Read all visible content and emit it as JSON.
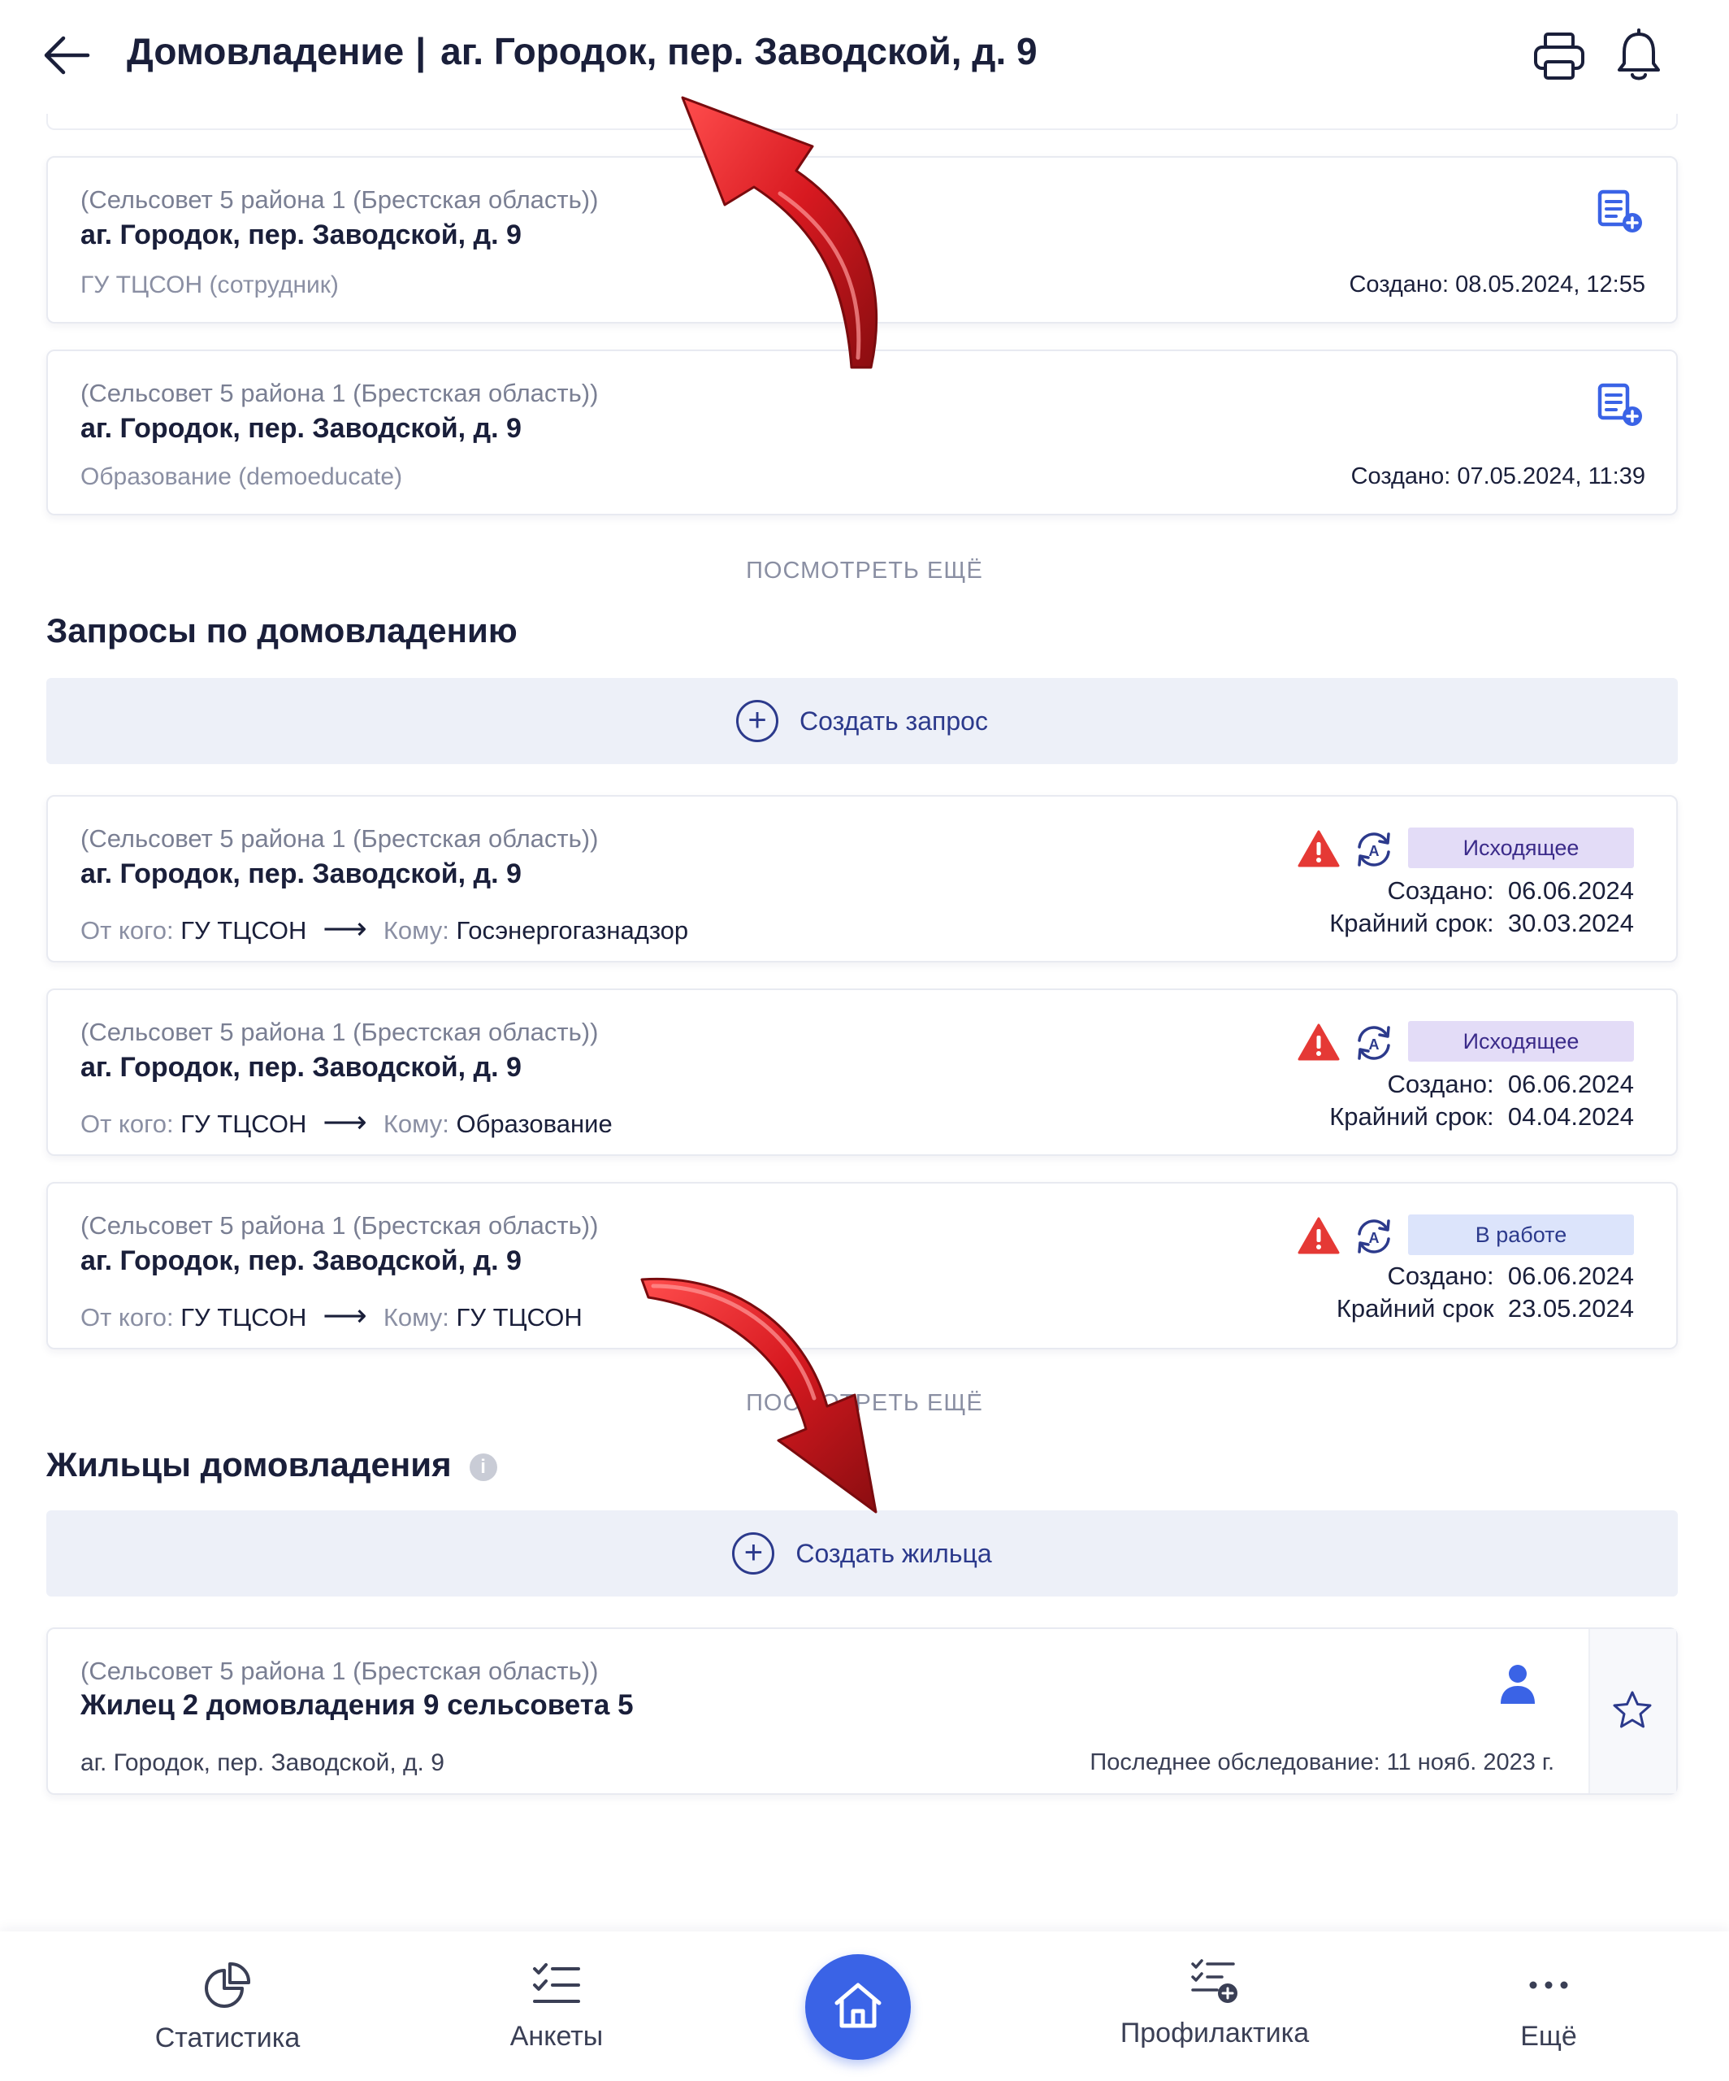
{
  "header": {
    "title_main": "Домовладение",
    "title_sep": "|",
    "title_address": "аг. Городок, пер. Заводской, д. 9"
  },
  "visits": {
    "items": [
      {
        "region": "(Сельсовет 5 района 1 (Брестская область))",
        "address": "аг. Городок, пер. Заводской, д. 9",
        "author": "ГУ ТЦСОН (сотрудник)",
        "created_label": "Создано:",
        "created_value": "08.05.2024, 12:55"
      },
      {
        "region": "(Сельсовет 5 района 1 (Брестская область))",
        "address": "аг. Городок, пер. Заводской, д. 9",
        "author": "Образование (demoeducate)",
        "created_label": "Создано:",
        "created_value": "07.05.2024, 11:39"
      }
    ],
    "more_label": "ПОСМОТРЕТЬ ЕЩЁ"
  },
  "requests": {
    "title": "Запросы по домовладению",
    "create_label": "Создать запрос",
    "items": [
      {
        "region": "(Сельсовет 5 района 1 (Брестская область))",
        "address": "аг. Городок, пер. Заводской, д. 9",
        "from_label": "От кого:",
        "from_value": "ГУ ТЦСОН",
        "to_label": "Кому:",
        "to_value": "Госэнергогазнадзор",
        "status": "Исходящее",
        "created_label": "Создано:",
        "created_value": "06.06.2024",
        "deadline_label": "Крайний срок:",
        "deadline_value": "30.03.2024"
      },
      {
        "region": "(Сельсовет 5 района 1 (Брестская область))",
        "address": "аг. Городок, пер. Заводской, д. 9",
        "from_label": "От кого:",
        "from_value": "ГУ ТЦСОН",
        "to_label": "Кому:",
        "to_value": "Образование",
        "status": "Исходящее",
        "created_label": "Создано:",
        "created_value": "06.06.2024",
        "deadline_label": "Крайний срок:",
        "deadline_value": "04.04.2024"
      },
      {
        "region": "(Сельсовет 5 района 1 (Брестская область))",
        "address": "аг. Городок, пер. Заводской, д. 9",
        "from_label": "От кого:",
        "from_value": "ГУ ТЦСОН",
        "to_label": "Кому:",
        "to_value": "ГУ ТЦСОН",
        "status": "В работе",
        "created_label": "Создано:",
        "created_value": "06.06.2024",
        "deadline_label": "Крайний срок",
        "deadline_value": "23.05.2024"
      }
    ],
    "more_label": "ПОСМОТРЕТЬ ЕЩЁ"
  },
  "residents": {
    "title": "Жильцы домовладения",
    "info_glyph": "i",
    "create_label": "Создать жильца",
    "items": [
      {
        "region": "(Сельсовет 5 района 1 (Брестская область))",
        "name": "Жилец 2 домовладения 9 сельсовета 5",
        "address": "аг. Городок, пер. Заводской, д. 9",
        "last_exam": "Последнее обследование: 11 нояб. 2023 г."
      }
    ]
  },
  "bottom_nav": {
    "statistics": "Статистика",
    "forms": "Анкеты",
    "prevention": "Профилактика",
    "more": "Ещё"
  },
  "colors": {
    "accent": "#3a63e6",
    "text_dark": "#1a1f3a",
    "muted": "#8a8fa3",
    "badge_outgoing_bg": "#e3dcf7",
    "badge_outgoing_text": "#3b2b8a",
    "badge_work_bg": "#dce4fb",
    "badge_work_text": "#2c3a8c",
    "warning_red": "#e53935",
    "annotation_red": "#d71920"
  },
  "icons": {
    "back": "arrow-left-icon",
    "print": "printer-icon",
    "notifications": "bell-icon",
    "visit": "document-add-icon",
    "warning": "warning-triangle-icon",
    "sync": "sync-auto-icon",
    "resident": "person-icon",
    "favorite": "star-icon",
    "statistics": "pie-chart-icon",
    "forms": "checklist-icon",
    "home": "home-icon",
    "prevention": "checklist-add-icon",
    "more": "dots-icon"
  }
}
